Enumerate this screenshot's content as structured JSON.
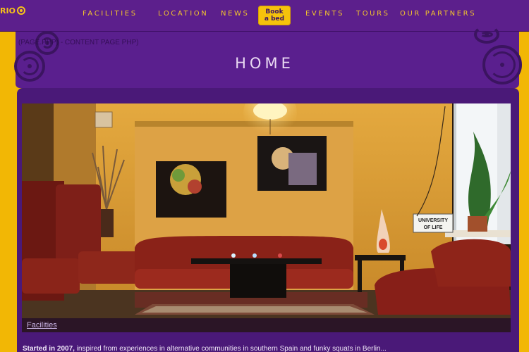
{
  "colors": {
    "nav_bg": "#5c1f8c",
    "page_bg": "#f2b705",
    "accent_yellow": "#f5c20c",
    "panel_purple": "#4a1978"
  },
  "logo": {
    "text": "RIO",
    "icon": "swirl-icon"
  },
  "nav": {
    "items": [
      {
        "label": "FACILITIES"
      },
      {
        "label": "LOCATION"
      },
      {
        "label": "NEWS"
      },
      {
        "label": "EVENTS"
      },
      {
        "label": "TOURS"
      },
      {
        "label": "OUR PARTNERS"
      }
    ],
    "book_line1": "Book",
    "book_line2": "a bed"
  },
  "header": {
    "php_note": "(PAGE.PHP) - CONTENT PAGE PHP)",
    "title": "HOME"
  },
  "photo": {
    "caption": "Facilities",
    "sign_line1": "UNIVERSITY",
    "sign_line2": "OF LIFE"
  },
  "intro": {
    "lead": "Started in 2007,",
    "rest": " inspired from experiences in alternative communities in southern Spain and funky squats in Berlin..."
  }
}
